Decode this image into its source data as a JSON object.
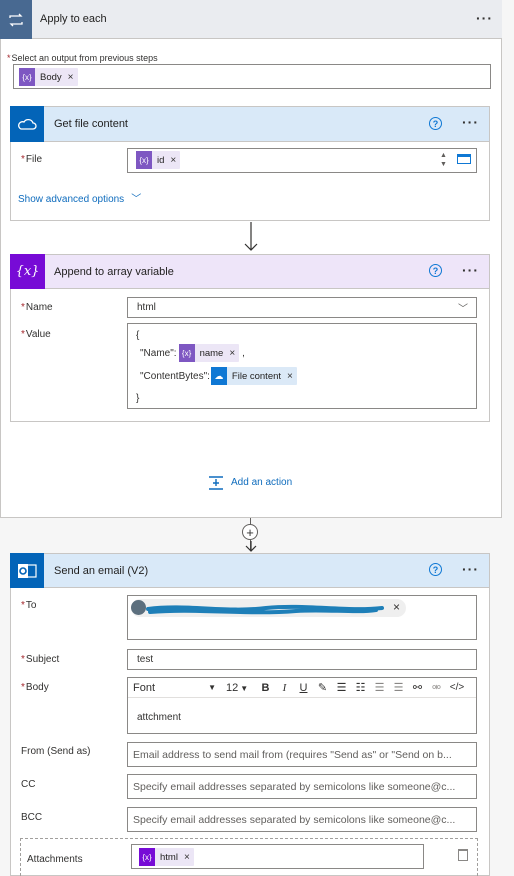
{
  "apply_each": {
    "title": "Apply to each",
    "output_label": "Select an output from previous steps",
    "token": "Body",
    "add_action": "Add an action"
  },
  "get_file": {
    "title": "Get file content",
    "file_label": "File",
    "file_token": "id",
    "advanced": "Show advanced options"
  },
  "append": {
    "title": "Append to array variable",
    "name_label": "Name",
    "name_value": "html",
    "value_label": "Value",
    "line_open": "{",
    "name_key": "\"Name\":",
    "name_token": "name",
    "comma": ",",
    "content_key": "\"ContentBytes\":",
    "content_token": "File content",
    "line_close": "}"
  },
  "email": {
    "title": "Send an email (V2)",
    "to_label": "To",
    "subject_label": "Subject",
    "subject_value": "test",
    "body_label": "Body",
    "font_value": "Font",
    "font_size": "12",
    "body_text": "attchment",
    "from_label": "From (Send as)",
    "from_placeholder": "Email address to send mail from (requires \"Send as\" or \"Send on b...",
    "cc_label": "CC",
    "cc_placeholder": "Specify email addresses separated by semicolons like someone@c...",
    "bcc_label": "BCC",
    "bcc_placeholder": "Specify email addresses separated by semicolons like someone@c...",
    "attach_label": "Attachments",
    "attach_token": "html"
  },
  "toolbar": {
    "bold": "B",
    "italic": "I",
    "underline": "U"
  },
  "colors": {
    "accent": "#0f78d4",
    "variable": "#7e57c2",
    "outlook_blue": "#0364b8"
  }
}
